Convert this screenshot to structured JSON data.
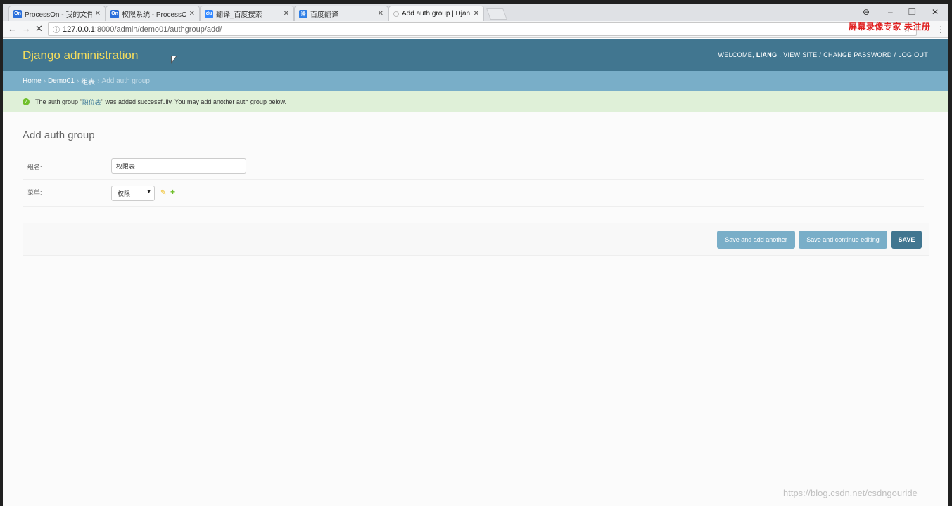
{
  "browser": {
    "tabs": [
      {
        "title": "ProcessOn - 我的文件",
        "favicon": "On",
        "favicon_color": "#2a6fdb",
        "active": false
      },
      {
        "title": "权限系统 - ProcessOn",
        "favicon": "On",
        "favicon_color": "#2a6fdb",
        "active": false
      },
      {
        "title": "翻译_百度搜索",
        "favicon": "du",
        "favicon_color": "#3388ff",
        "active": false
      },
      {
        "title": "百度翻译",
        "favicon": "译",
        "favicon_color": "#2f7fe6",
        "active": false
      },
      {
        "title": "Add auth group | Djan",
        "favicon": "",
        "favicon_color": "#cccccc",
        "active": true
      }
    ],
    "url_host": "127.0.0.1",
    "url_path": ":8000/admin/demo01/authgroup/add/",
    "overlay_text": "屏幕录像专家 未注册"
  },
  "header": {
    "branding": "Django administration",
    "welcome": "WELCOME,",
    "username": "LIANG",
    "view_site": "VIEW SITE",
    "change_password": "CHANGE PASSWORD",
    "log_out": "LOG OUT",
    "separator": "/"
  },
  "breadcrumbs": {
    "home": "Home",
    "app": "Demo01",
    "model": "组表",
    "current": "Add auth group",
    "separator": "›"
  },
  "message": {
    "prefix": "The auth group \"",
    "link": "职位表",
    "suffix": "\" was added successfully. You may add another auth group below."
  },
  "form": {
    "title": "Add auth group",
    "fields": {
      "name": {
        "label": "组名:",
        "value": "权限表"
      },
      "menu": {
        "label": "菜单:",
        "selected": "权限"
      }
    }
  },
  "submit": {
    "save_add_another": "Save and add another",
    "save_continue": "Save and continue editing",
    "save": "SAVE"
  },
  "footer": {
    "watermark": "https://blog.csdn.net/csdngouride"
  },
  "colors": {
    "header_bg": "#417690",
    "branding": "#f5dd5d",
    "breadcrumbs_bg": "#79aec8",
    "success_bg": "#dff0d8"
  }
}
